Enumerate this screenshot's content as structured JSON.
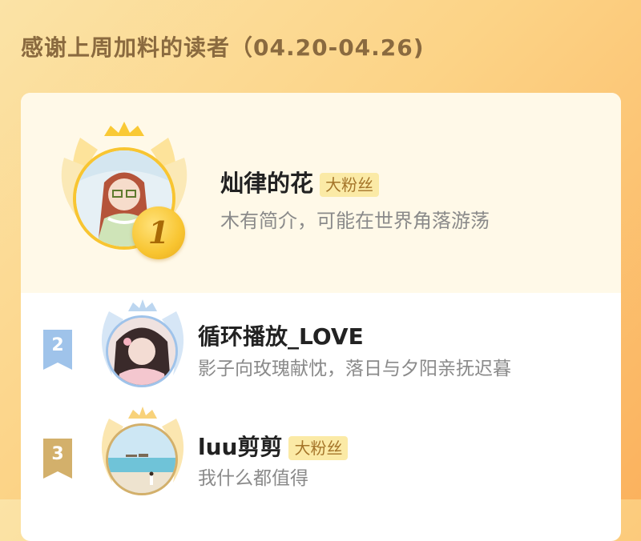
{
  "header": {
    "title": "感谢上周加料的读者（04.20-04.26)"
  },
  "readers": [
    {
      "rank": "1",
      "name": "灿律的花",
      "badge": "大粉丝",
      "bio": "木有简介，可能在世界角落游荡"
    },
    {
      "rank": "2",
      "name": "循环播放_LOVE",
      "badge": "",
      "bio": "影子向玫瑰献忱，落日与夕阳亲抚迟暮"
    },
    {
      "rank": "3",
      "name": "luu剪剪",
      "badge": "大粉丝",
      "bio": "我什么都值得"
    }
  ],
  "colors": {
    "background_gradient": [
      "#fbe3a6",
      "#fbb25e"
    ],
    "title": "#8a6a3f",
    "badge_bg": "#fbeaa6",
    "badge_text": "#a5752a",
    "gold": "#f8c531",
    "silver_blue": "#9fc3ea",
    "bronze": "#d3b06b"
  }
}
